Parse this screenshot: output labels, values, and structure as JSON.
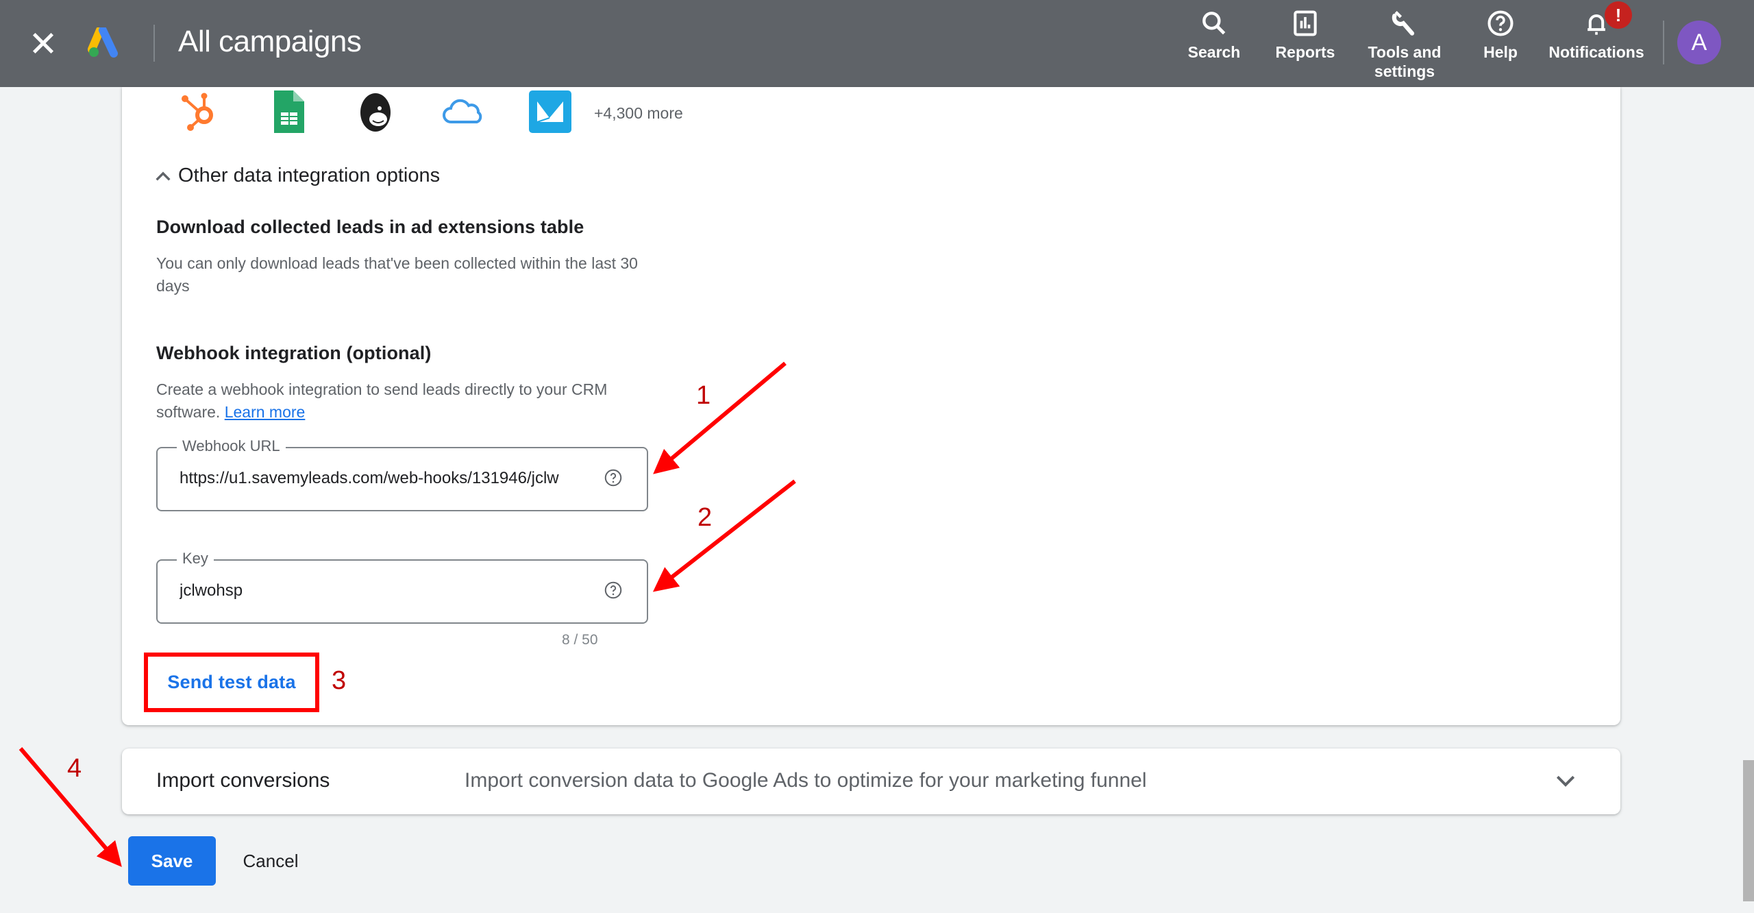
{
  "header": {
    "title": "All campaigns",
    "nav": [
      {
        "label": "Search",
        "icon": "search-icon"
      },
      {
        "label": "Reports",
        "icon": "reports-icon"
      },
      {
        "label": "Tools and settings",
        "icon": "wrench-icon"
      },
      {
        "label": "Help",
        "icon": "help-icon"
      },
      {
        "label": "Notifications",
        "icon": "bell-icon"
      }
    ],
    "notification_badge": "!",
    "avatar_initial": "A"
  },
  "integrations": {
    "icons": [
      "hubspot-icon",
      "google-sheets-icon",
      "mailchimp-icon",
      "salesforce-cloud-icon",
      "email-app-icon"
    ],
    "more_label": "+4,300 more"
  },
  "other_options": {
    "toggle_label": "Other data integration options",
    "download": {
      "heading": "Download collected leads in ad extensions table",
      "description": "You can only download leads that've been collected within the last 30 days"
    },
    "webhook": {
      "heading": "Webhook integration (optional)",
      "description": "Create a webhook integration to send leads directly to your CRM software.",
      "learn_more": "Learn more",
      "url_field": {
        "label": "Webhook URL",
        "value": "https://u1.savemyleads.com/web-hooks/131946/jclw"
      },
      "key_field": {
        "label": "Key",
        "value": "jclwohsp",
        "counter": "8 / 50"
      },
      "send_test_label": "Send test data"
    }
  },
  "import_conversions": {
    "title": "Import conversions",
    "description": "Import conversion data to Google Ads to optimize for your marketing funnel"
  },
  "actions": {
    "save": "Save",
    "cancel": "Cancel"
  },
  "annotations": {
    "n1": "1",
    "n2": "2",
    "n3": "3",
    "n4": "4",
    "color": "#ff0000"
  }
}
